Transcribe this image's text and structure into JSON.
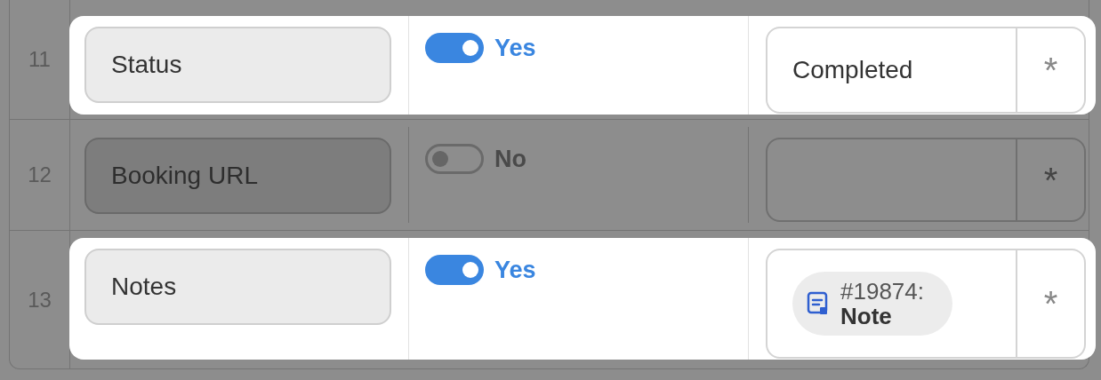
{
  "rows": [
    {
      "number": "11",
      "field": "Status",
      "highlighted": true,
      "toggle": {
        "on": true,
        "label": "Yes"
      },
      "value": {
        "kind": "text",
        "text": "Completed"
      },
      "action": "*"
    },
    {
      "number": "12",
      "field": "Booking URL",
      "highlighted": false,
      "toggle": {
        "on": false,
        "label": "No"
      },
      "value": {
        "kind": "empty"
      },
      "action": "*"
    },
    {
      "number": "13",
      "field": "Notes",
      "highlighted": true,
      "toggle": {
        "on": true,
        "label": "Yes"
      },
      "value": {
        "kind": "record",
        "id": "#19874:",
        "title": "Note"
      },
      "action": "*"
    }
  ]
}
